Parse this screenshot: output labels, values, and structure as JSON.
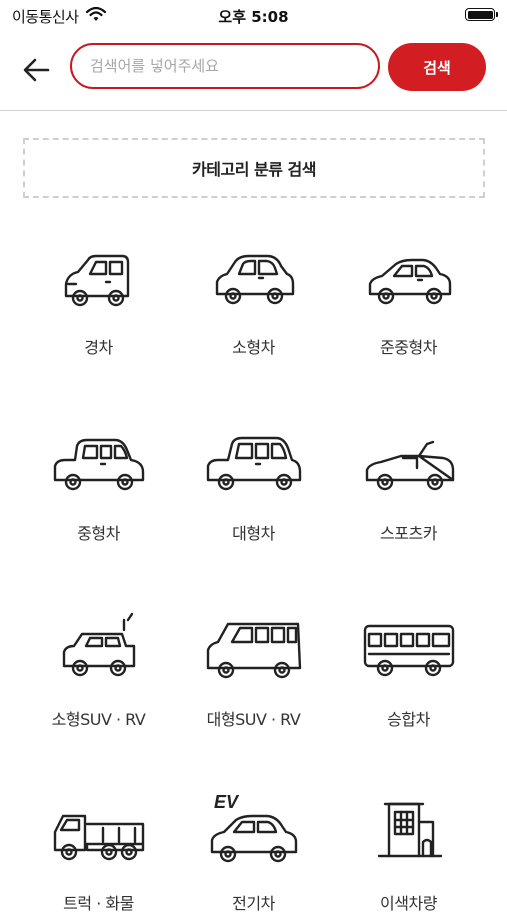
{
  "status_bar": {
    "carrier": "이동통신사",
    "time": "오후 5:08"
  },
  "search": {
    "placeholder": "검색어를 넣어주세요",
    "button_label": "검색"
  },
  "category_search": {
    "label": "카테고리 분류 검색"
  },
  "categories": [
    {
      "label": "경차",
      "icon": "mini-car-icon"
    },
    {
      "label": "소형차",
      "icon": "small-car-icon"
    },
    {
      "label": "준중형차",
      "icon": "compact-car-icon"
    },
    {
      "label": "중형차",
      "icon": "midsize-car-icon"
    },
    {
      "label": "대형차",
      "icon": "large-car-icon"
    },
    {
      "label": "스포츠카",
      "icon": "sports-car-icon"
    },
    {
      "label": "소형SUV · RV",
      "icon": "small-suv-icon"
    },
    {
      "label": "대형SUV · RV",
      "icon": "large-suv-icon"
    },
    {
      "label": "승합차",
      "icon": "bus-icon"
    },
    {
      "label": "트럭 · 화물",
      "icon": "truck-icon"
    },
    {
      "label": "전기차",
      "icon": "electric-car-icon",
      "badge": "EV"
    },
    {
      "label": "이색차량",
      "icon": "building-icon"
    }
  ]
}
